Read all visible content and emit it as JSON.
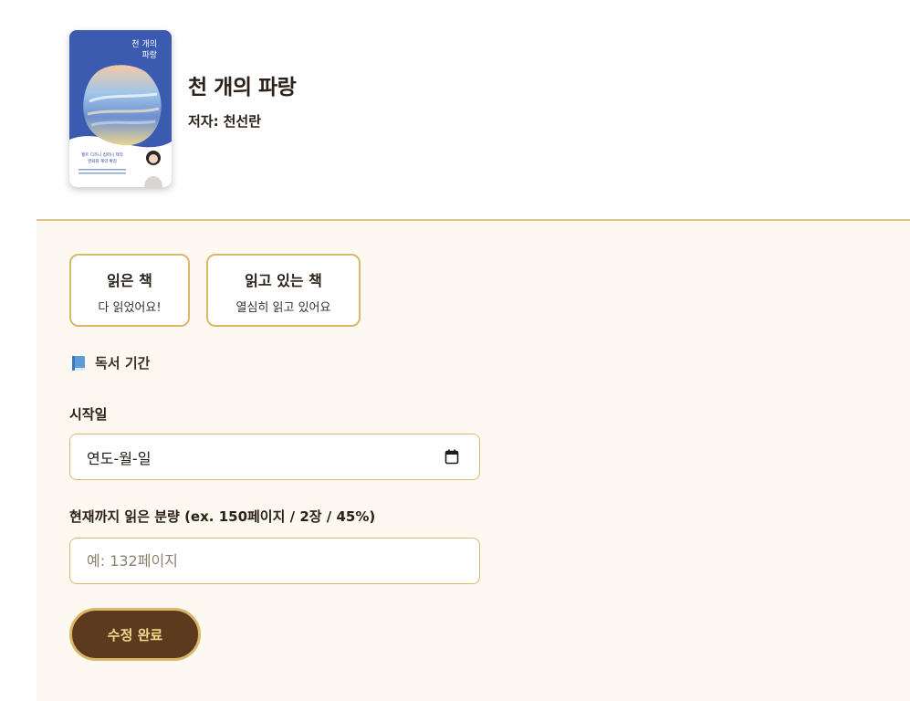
{
  "book": {
    "title": "천 개의 파랑",
    "author_label": "저자:",
    "author": "천선란",
    "cover": {
      "title_line1": "천 개의",
      "title_line2": "파랑",
      "tagline_line1": "월트 디즈니 컴퍼니 제작",
      "tagline_line2": "영화화 계약 확정",
      "colors": {
        "top": "#3a5bb0",
        "bottom": "#ffffff",
        "accent": "#2a4a9a"
      }
    }
  },
  "status_options": [
    {
      "title": "읽은 책",
      "subtitle": "다 읽었어요!"
    },
    {
      "title": "읽고 있는 책",
      "subtitle": "열심히 읽고 있어요"
    }
  ],
  "reading_period": {
    "heading": "독서 기간",
    "icon": "blue-book-icon"
  },
  "form": {
    "start_date_label": "시작일",
    "start_date_placeholder": "연도-월-일",
    "amount_label": "현재까지 읽은 분량 (ex. 150페이지 / 2장 / 45%)",
    "amount_placeholder": "예: 132페이지",
    "submit_label": "수정 완료"
  },
  "colors": {
    "accent_border": "#d8b86c",
    "panel_bg": "#fdf9f0",
    "button_bg": "#5b3a1e",
    "button_text": "#f6d68c"
  }
}
